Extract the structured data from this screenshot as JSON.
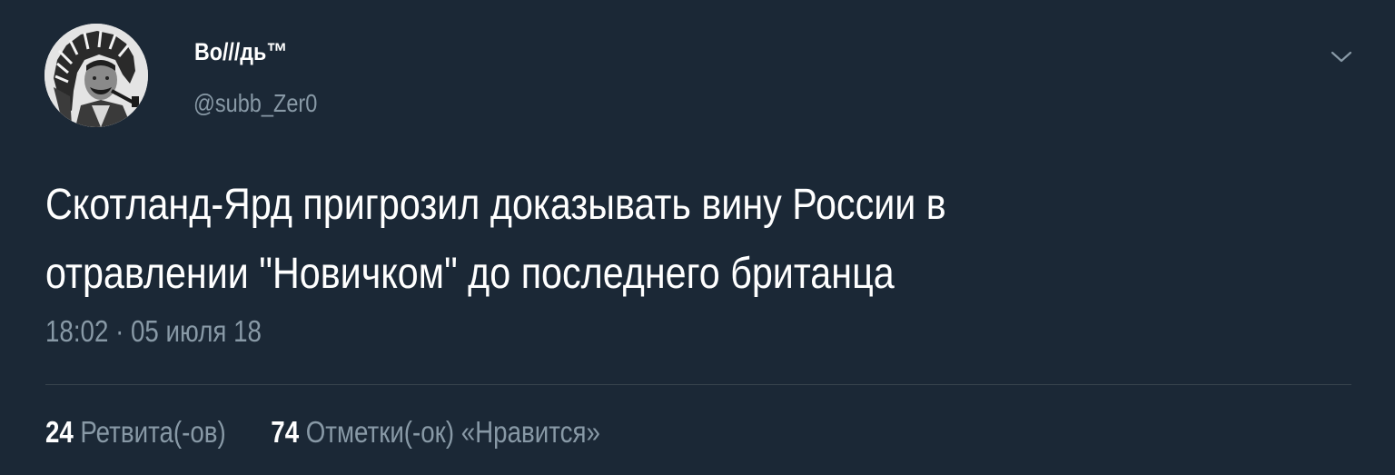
{
  "user": {
    "display_name": "Во///дь™",
    "handle": "@subb_Zer0"
  },
  "tweet": {
    "lines": [
      "Скотланд-Ярд пригрозил доказывать вину России в",
      "отравлении \"Новичком\" до последнего британца"
    ],
    "timestamp": "18:02 · 05 июля 18"
  },
  "stats": {
    "retweets": {
      "count": "24",
      "label": "Ретвита(-ов)"
    },
    "likes": {
      "count": "74",
      "label": "Отметки(-ок) «Нравится»"
    }
  },
  "icons": {
    "menu": "chevron-down-icon",
    "avatar": "avatar"
  },
  "colors": {
    "background": "#1b2836",
    "primary_text": "#ffffff",
    "secondary_text": "#8899a6",
    "divider": "#38444d"
  }
}
